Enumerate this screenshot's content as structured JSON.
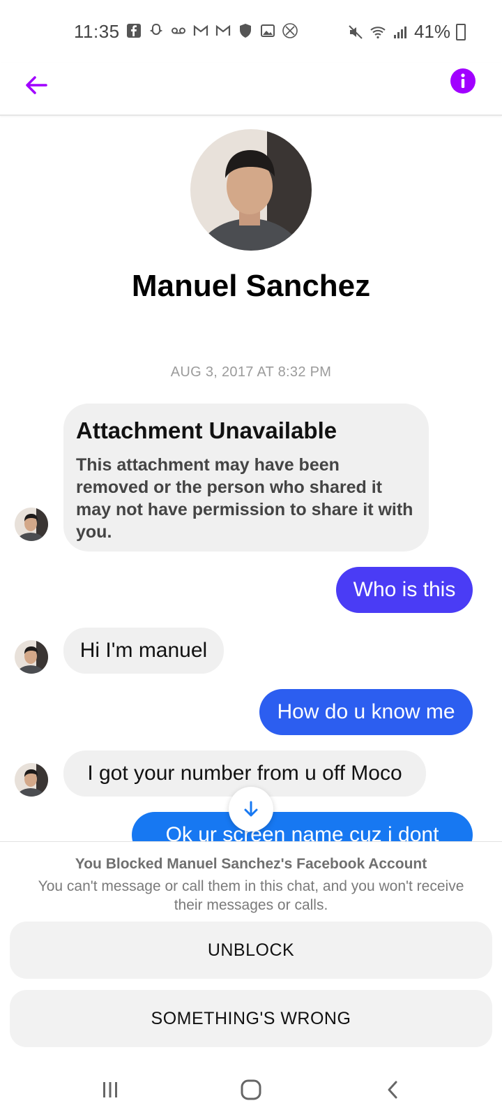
{
  "status_bar": {
    "time": "11:35",
    "battery": "41%",
    "left_icons": [
      "facebook-icon",
      "snapchat-icon",
      "voicemail-icon",
      "gmail-icon",
      "gmail-icon",
      "shield-icon",
      "gallery-icon",
      "blocked-icon"
    ],
    "right_icons": [
      "mute-icon",
      "wifi-icon",
      "signal-icon",
      "battery-icon"
    ]
  },
  "header": {
    "accent_color": "#a100ff"
  },
  "profile": {
    "name": "Manuel Sanchez"
  },
  "conversation": {
    "timestamp": "AUG 3, 2017 AT 8:32 PM",
    "attachment": {
      "title": "Attachment Unavailable",
      "body": "This attachment may have been removed or the person who shared it may not have permission to share it with you."
    },
    "messages": [
      {
        "direction": "out",
        "text": "Who is this",
        "color": "#4a3cf5"
      },
      {
        "direction": "in",
        "text": "Hi I'm manuel"
      },
      {
        "direction": "out",
        "text": "How do u know me",
        "color": "#2c5ef0"
      },
      {
        "direction": "in",
        "text": "I got your number from u off Moco"
      },
      {
        "direction": "out",
        "text": "Ok ur screen name cuz i dont",
        "color": "#1778f2"
      }
    ]
  },
  "blocked_panel": {
    "title": "You Blocked Manuel Sanchez's Facebook Account",
    "description": "You can't message or call them in this chat, and you won't receive their messages or calls.",
    "unblock_label": "UNBLOCK",
    "wrong_label": "SOMETHING'S WRONG"
  },
  "nav_bar": {
    "icons": [
      "recent-apps-icon",
      "home-icon",
      "back-nav-icon"
    ]
  }
}
